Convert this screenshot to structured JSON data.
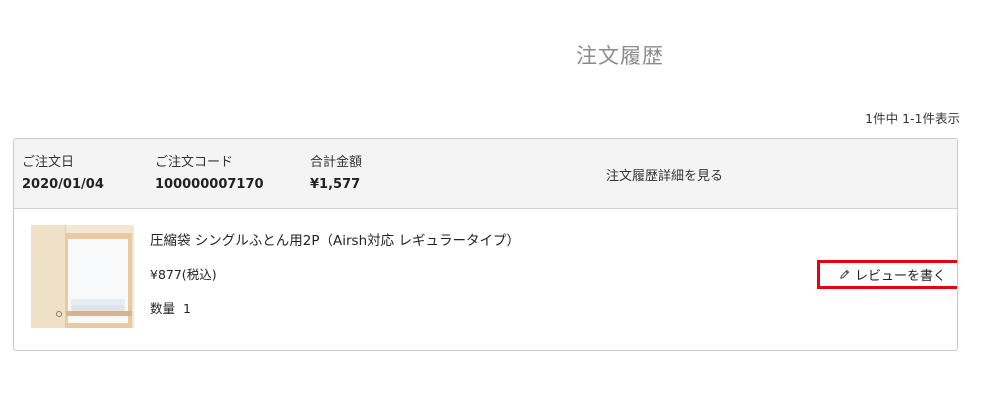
{
  "page": {
    "title": "注文履歴",
    "result_count": "1件中 1-1件表示"
  },
  "order": {
    "date_label": "ご注文日",
    "date_value": "2020/01/04",
    "code_label": "ご注文コード",
    "code_value": "100000007170",
    "total_label": "合計金額",
    "total_value": "¥1,577",
    "detail_link": "注文履歴詳細を見る",
    "item": {
      "name": "圧縮袋 シングルふとん用2P（Airsh対応 レギュラータイプ）",
      "price": "¥877(税込)",
      "qty_label": "数量",
      "qty_value": "1",
      "review_button": "レビューを書く",
      "icon": "pencil-icon"
    }
  }
}
